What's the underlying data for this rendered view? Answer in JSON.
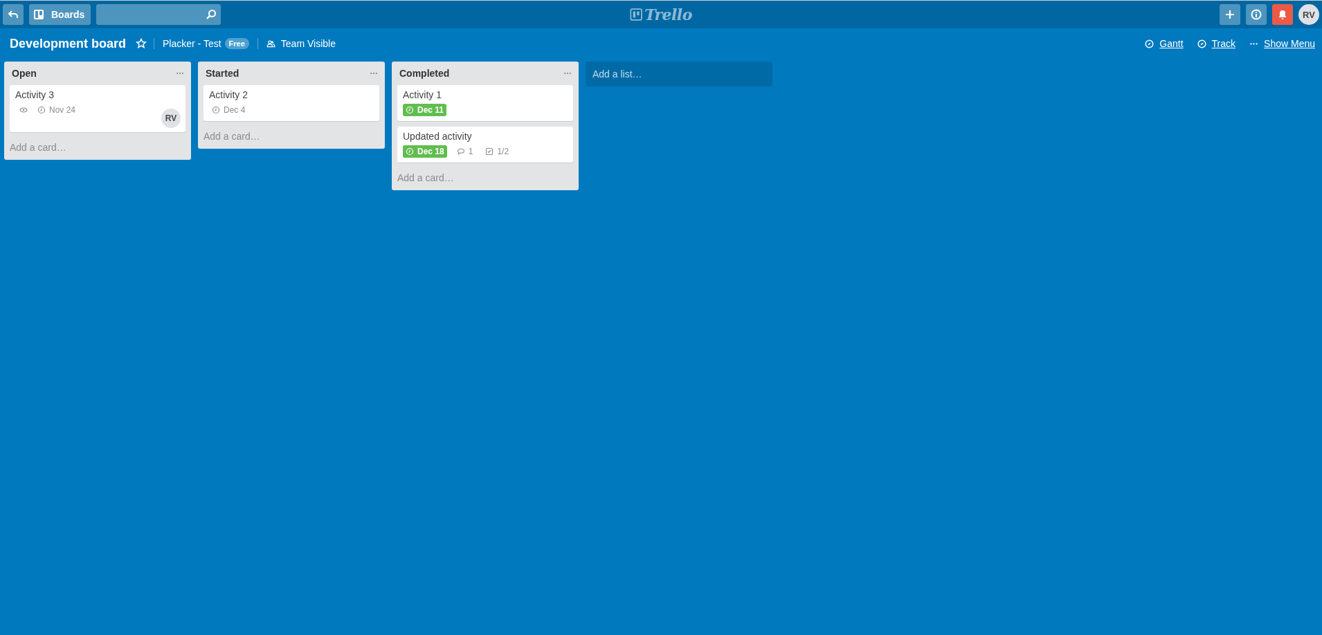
{
  "topbar": {
    "boards_button": "Boards",
    "logo": "Trello",
    "avatar": "RV"
  },
  "board": {
    "title": "Development board",
    "starred": false,
    "team": "Placker - Test",
    "plan_badge": "Free",
    "visibility": "Team Visible",
    "links": [
      {
        "kind": "gantt",
        "label": "Gantt"
      },
      {
        "kind": "track",
        "label": "Track"
      },
      {
        "kind": "menu",
        "label": "Show Menu"
      }
    ]
  },
  "lists": [
    {
      "title": "Open",
      "add_card": "Add a card…",
      "cards": [
        {
          "title": "Activity 3",
          "members": [
            "RV"
          ],
          "badges": [
            {
              "kind": "watch"
            },
            {
              "kind": "due",
              "text": "Nov 24",
              "complete": false
            }
          ]
        }
      ]
    },
    {
      "title": "Started",
      "add_card": "Add a card…",
      "cards": [
        {
          "title": "Activity 2",
          "badges": [
            {
              "kind": "due",
              "text": "Dec 4",
              "complete": false
            }
          ]
        }
      ]
    },
    {
      "title": "Completed",
      "add_card": "Add a card…",
      "cards": [
        {
          "title": "Activity 1",
          "badges": [
            {
              "kind": "due",
              "text": "Dec 11",
              "complete": true
            }
          ]
        },
        {
          "title": "Updated activity",
          "badges": [
            {
              "kind": "due",
              "text": "Dec 18",
              "complete": true
            },
            {
              "kind": "comments",
              "text": "1"
            },
            {
              "kind": "checklist",
              "text": "1/2"
            }
          ]
        }
      ]
    }
  ],
  "add_list": "Add a list…"
}
